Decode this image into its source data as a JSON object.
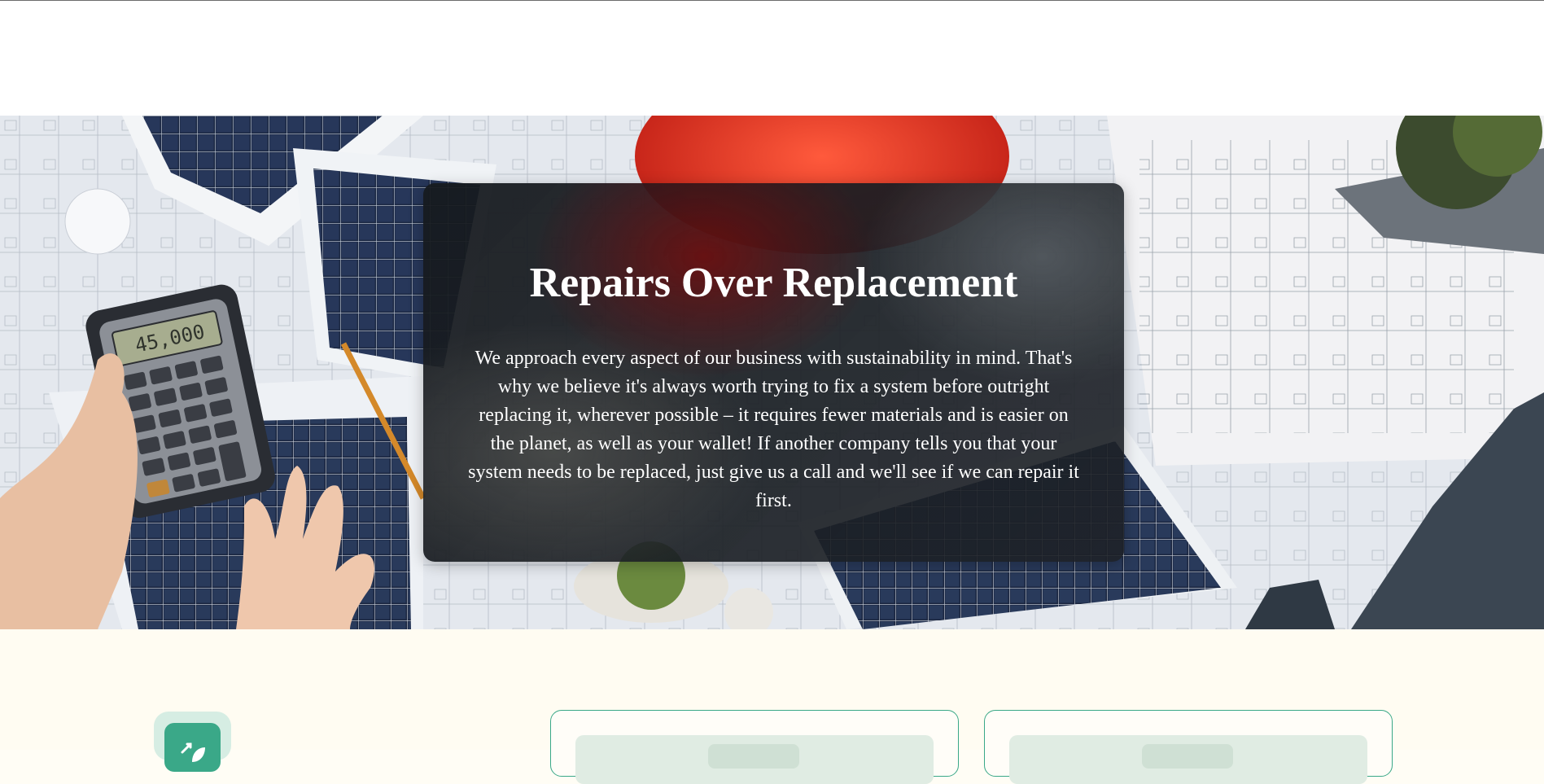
{
  "hero": {
    "title": "Repairs Over Replacement",
    "text": "We approach every aspect of our business with sustainability in mind. That's why we believe it's always worth trying to fix a system before outright replacing it, wherever possible – it requires fewer materials and is easier on the planet, as well as your wallet! If another company tells you that your system needs to be replaced, just give us a call and we'll see if we can repair it first.",
    "background_image": "hands-calculator-solar-panels-blueprints"
  },
  "calculator": {
    "display": "45,000"
  },
  "feature": {
    "icon": "leaf-icon",
    "accent_color": "#3aa888"
  },
  "colors": {
    "card_border": "#3aa888",
    "page_background": "#fffdf5"
  }
}
